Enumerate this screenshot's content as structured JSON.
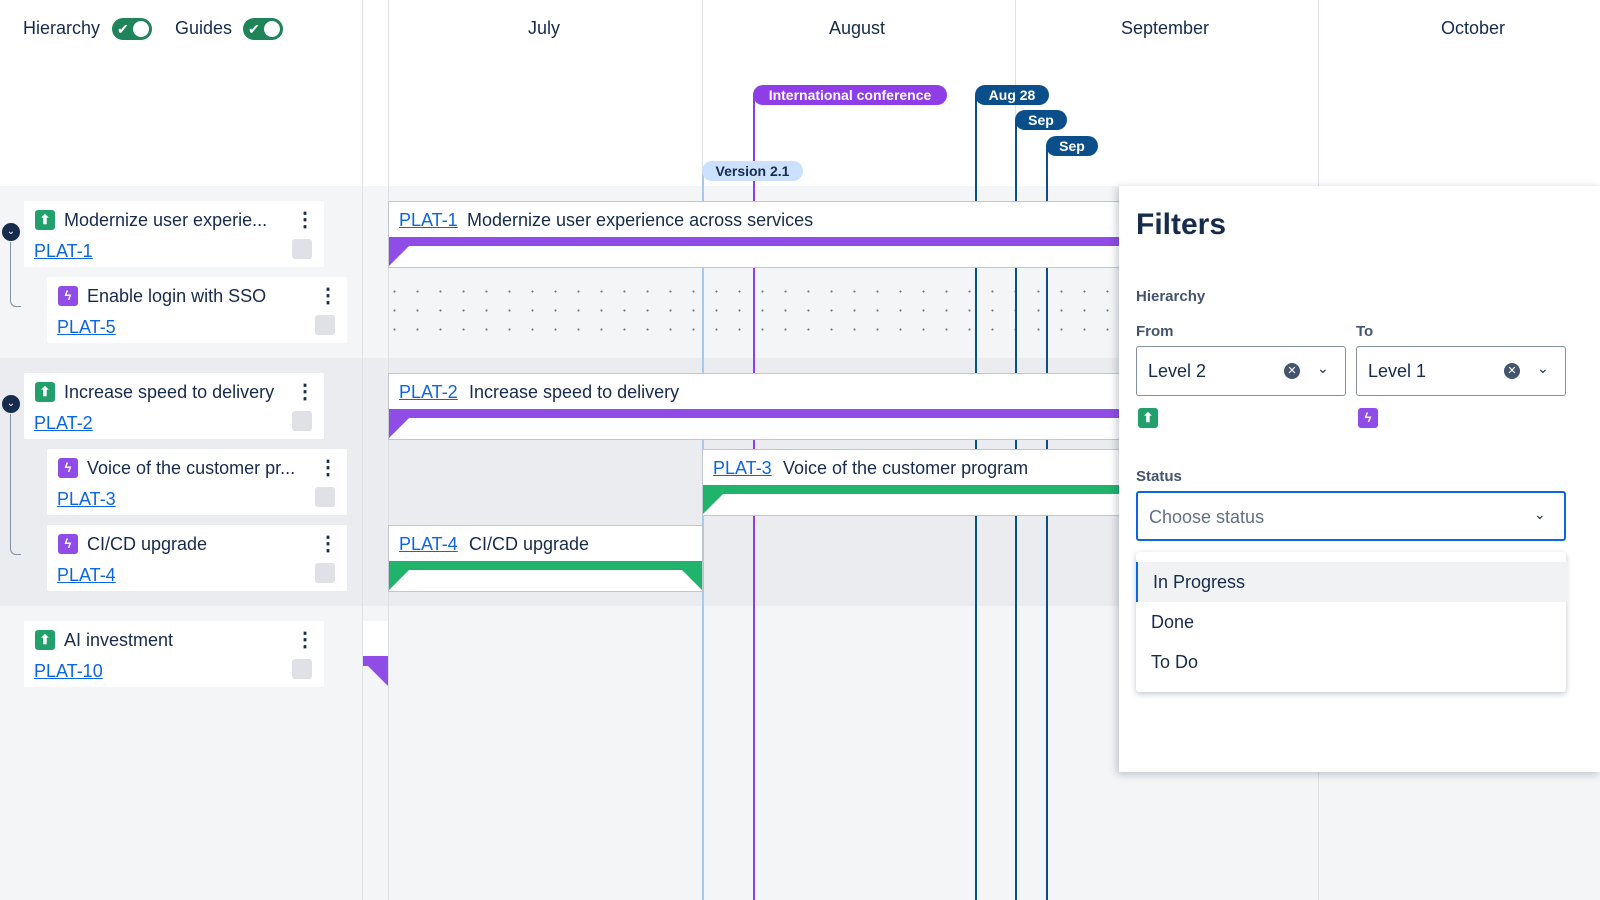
{
  "toolbar": {
    "hierarchy_label": "Hierarchy",
    "guides_label": "Guides",
    "hierarchy_on": true,
    "guides_on": true
  },
  "months": [
    "July",
    "August",
    "September",
    "October"
  ],
  "markers": [
    {
      "label": "International conference",
      "color": "#8f3de6"
    },
    {
      "label": "Aug 28",
      "color": "#0b4f8a"
    },
    {
      "label": "Sep",
      "color": "#0b4f8a"
    },
    {
      "label": "Sep",
      "color": "#0b4f8a"
    },
    {
      "label": "Version 2.1",
      "color": "#cce0ff"
    }
  ],
  "items": [
    {
      "title": "Modernize user experie...",
      "key": "PLAT-1",
      "type": "epic-icon"
    },
    {
      "title": "Enable login with SSO",
      "key": "PLAT-5",
      "type": "story-icon"
    },
    {
      "title": "Increase speed to delivery",
      "key": "PLAT-2",
      "type": "epic-icon"
    },
    {
      "title": "Voice of the customer pr...",
      "key": "PLAT-3",
      "type": "story-icon"
    },
    {
      "title": "CI/CD upgrade",
      "key": "PLAT-4",
      "type": "story-icon"
    },
    {
      "title": "AI investment",
      "key": "PLAT-10",
      "type": "epic-icon"
    }
  ],
  "bars": [
    {
      "key": "PLAT-1",
      "title": "Modernize user experience across services",
      "color": "#8f4ce6"
    },
    {
      "key": "PLAT-2",
      "title": "Increase speed to delivery",
      "color": "#8f4ce6"
    },
    {
      "key": "PLAT-3",
      "title": "Voice of the customer program",
      "color": "#1fb36b"
    },
    {
      "key": "PLAT-4",
      "title": "CI/CD upgrade",
      "color": "#1fb36b"
    }
  ],
  "filters": {
    "title": "Filters",
    "hierarchy_label": "Hierarchy",
    "from_label": "From",
    "to_label": "To",
    "from_value": "Level 2",
    "to_value": "Level 1",
    "status_label": "Status",
    "status_placeholder": "Choose status",
    "status_options": [
      "In Progress",
      "Done",
      "To Do"
    ]
  }
}
